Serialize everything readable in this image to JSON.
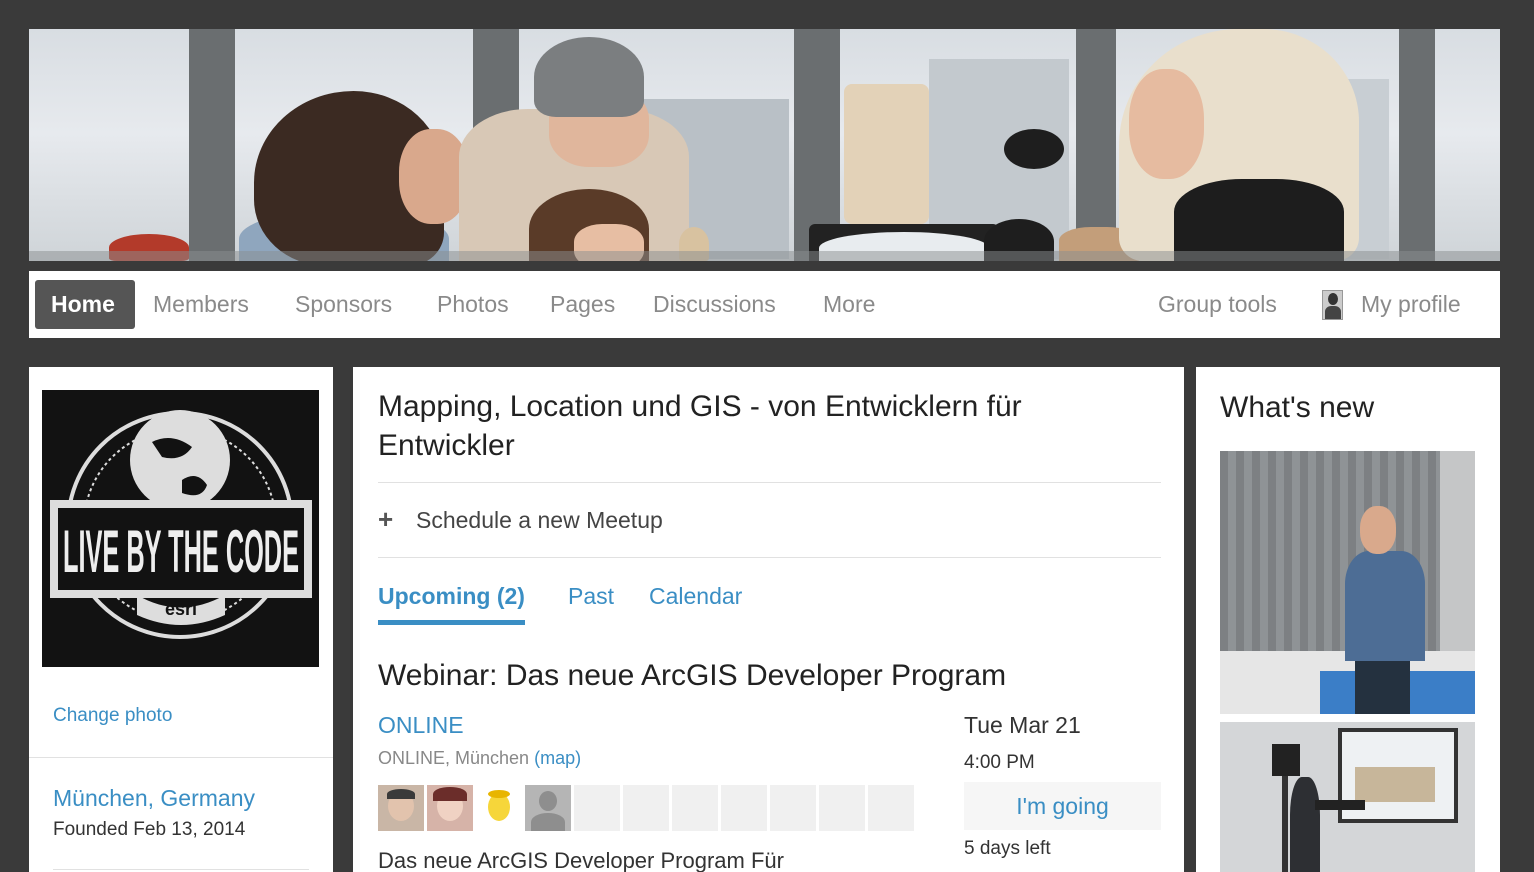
{
  "nav": {
    "home": "Home",
    "members": "Members",
    "sponsors": "Sponsors",
    "photos": "Photos",
    "pages": "Pages",
    "discussions": "Discussions",
    "more": "More",
    "group_tools": "Group tools",
    "my_profile": "My profile"
  },
  "group": {
    "logo_text": "LIVE BY THE CODE",
    "logo_subtext": "esri",
    "change_photo": "Change photo",
    "location": "München, Germany",
    "founded": "Founded Feb 13, 2014",
    "title": "Mapping, Location und GIS - von Entwicklern für Entwickler"
  },
  "actions": {
    "schedule": "Schedule a new Meetup"
  },
  "tabs": {
    "upcoming": "Upcoming (2)",
    "past": "Past",
    "calendar": "Calendar"
  },
  "event": {
    "title": "Webinar: Das neue ArcGIS Developer Program",
    "venue": "ONLINE",
    "address": "ONLINE, München",
    "map_link": "(map)",
    "date": "Tue Mar 21",
    "time": "4:00 PM",
    "rsvp": "I'm going",
    "days_left": "5 days left",
    "description": "Das neue ArcGIS Developer Program Für"
  },
  "sidebar_right": {
    "title": "What's new"
  },
  "colors": {
    "link": "#3a8ec4",
    "nav_active_bg": "#555555",
    "page_bg": "#3a3a3a"
  }
}
